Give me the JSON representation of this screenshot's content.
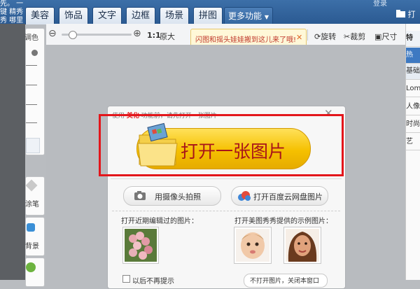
{
  "top_toolbar": {
    "tabs": [
      "美容",
      "饰品",
      "文字",
      "边框",
      "场景",
      "拼图"
    ],
    "more": "更多功能",
    "open_label": "打开",
    "left_snippet": "先。 一键  精秀秀  哪里功能",
    "right_snippet": "登录"
  },
  "toolbar2": {
    "zoom_minus": "⊖",
    "zoom_plus": "⊕",
    "one_to_one": "1:1",
    "original_size": "原大",
    "rotate": "旋转",
    "crop": "裁剪",
    "size": "尺寸",
    "zoom_level": 0.15
  },
  "notice": {
    "text": "闪图和摇头娃娃搬到这儿来了哦!",
    "close": "✕"
  },
  "left_panel": {
    "label_top": "调色",
    "label_mid": "涂笔",
    "label_bottom": "背景"
  },
  "right_panel": {
    "header": "特",
    "tabs": [
      "热",
      "基础",
      "Lom",
      "人像",
      "时尚",
      "艺"
    ]
  },
  "dialog": {
    "hint_prefix": "使用",
    "hint_brand": "美化",
    "hint_suffix": "功能前，请先打开一张图片",
    "close": "✕",
    "open_button": "打开一张图片",
    "camera_button": "用摄像头拍照",
    "cloud_button": "打开百度云网盘图片",
    "recent_label": "打开近期编辑过的图片：",
    "sample_label": "打开美图秀秀提供的示例图片：",
    "footer_left": "以后不再提示",
    "footer_right": "不打开图片，关闭本窗口"
  },
  "colors": {
    "highlight": "#e3161b",
    "open_button": "#f5c000",
    "toolbar": "#2f5f96"
  }
}
